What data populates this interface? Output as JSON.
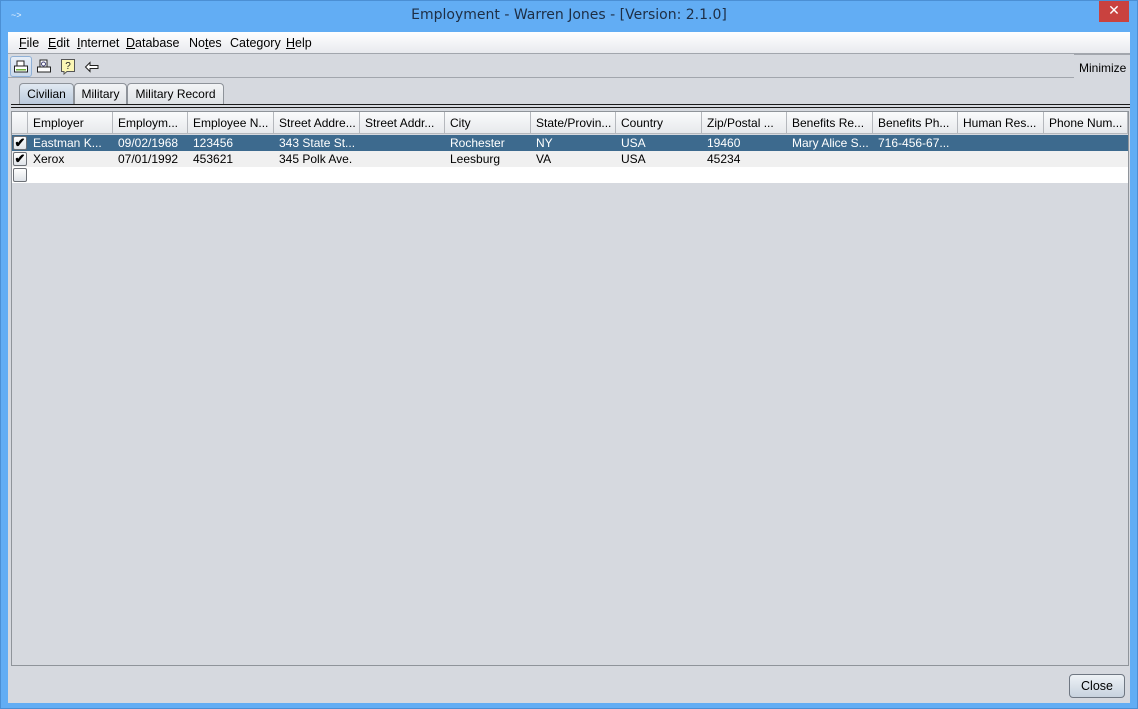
{
  "window": {
    "title": "Employment - Warren Jones - [Version: 2.1.0]",
    "app_icon": "java-cup-icon",
    "close_glyph": "✕"
  },
  "menubar": {
    "items": [
      {
        "label": "File",
        "mnemonic": "F",
        "rest": "ile"
      },
      {
        "label": "Edit",
        "mnemonic": "E",
        "rest": "dit"
      },
      {
        "label": "Internet",
        "mnemonic": "I",
        "rest": "nternet"
      },
      {
        "label": "Database",
        "mnemonic": "D",
        "rest": "atabase"
      },
      {
        "label": "Notes",
        "pre": "No",
        "mnemonic": "t",
        "rest": "es"
      },
      {
        "label": "Category",
        "pre": "Cate",
        "mnemonic": "g",
        "rest": "ory"
      },
      {
        "label": "Help",
        "mnemonic": "H",
        "rest": "elp"
      }
    ]
  },
  "toolbar": {
    "buttons": [
      {
        "icon": "print-icon"
      },
      {
        "icon": "print-preview-icon"
      },
      {
        "icon": "help-icon"
      },
      {
        "icon": "back-arrow-icon"
      }
    ],
    "minimize_label": "Minimize"
  },
  "tabs": [
    {
      "label": "Civilian",
      "selected": true
    },
    {
      "label": "Military",
      "selected": false
    },
    {
      "label": "Military Record",
      "selected": false
    }
  ],
  "table": {
    "columns": [
      "",
      "Employer",
      "Employm...",
      "Employee N...",
      "Street Addre...",
      "Street Addr...",
      "City",
      "State/Provin...",
      "Country",
      "Zip/Postal ...",
      "Benefits Re...",
      "Benefits Ph...",
      "Human Res...",
      "Phone Num..."
    ],
    "rows": [
      {
        "checked": true,
        "selected": true,
        "cells": [
          "Eastman K...",
          "09/02/1968",
          "123456",
          "343 State St...",
          "",
          "Rochester",
          "NY",
          "USA",
          "19460",
          "Mary Alice S...",
          "716-456-67...",
          "",
          ""
        ]
      },
      {
        "checked": true,
        "selected": false,
        "cells": [
          "Xerox",
          "07/01/1992",
          "453621",
          "345 Polk Ave.",
          "",
          "Leesburg",
          "VA",
          "USA",
          "45234",
          "",
          "",
          "",
          ""
        ]
      },
      {
        "checked": false,
        "selected": false,
        "cells": [
          "",
          "",
          "",
          "",
          "",
          "",
          "",
          "",
          "",
          "",
          "",
          "",
          ""
        ]
      }
    ],
    "check_glyph": "✔"
  },
  "footer": {
    "close_label": "Close"
  }
}
